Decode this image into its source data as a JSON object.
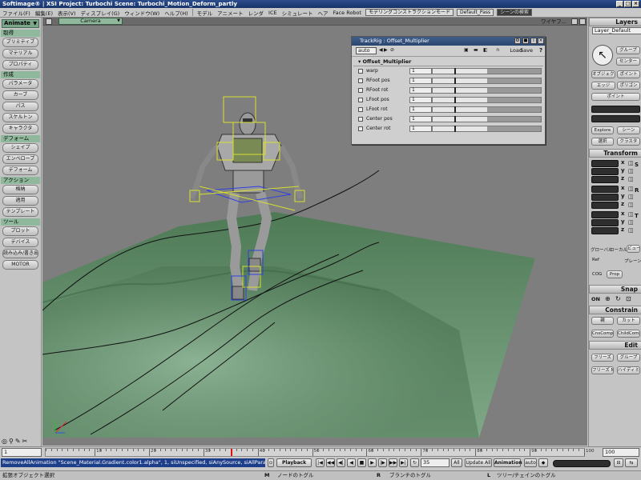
{
  "window": {
    "title": "Softimage® | XSI Project: Turbochi   Scene: Turbochi_Motion_Deform_partly",
    "buttons": [
      "_",
      "□",
      "×"
    ]
  },
  "menubar": {
    "items": [
      "ファイル(F)",
      "編集(E)",
      "表示(V)",
      "ディスプレイ(G)",
      "ウィンドウ(W)",
      "ヘルプ(H)",
      "モデル",
      "アニメート",
      "レンダ",
      "ICE",
      "シミュレート",
      "ヘア",
      "Face Robot"
    ],
    "mode_field": "モデリングコンストラクションモード",
    "pass_field": "Default_Pass",
    "search_placeholder": "シーンの検索"
  },
  "left_panel": {
    "mode": "Animate",
    "sections": [
      {
        "header": "取得",
        "buttons": [
          "プリミティブ",
          "マテリアル",
          "プロパティ"
        ]
      },
      {
        "header": "作成",
        "buttons": [
          "パラメータ",
          "カーブ",
          "パス",
          "スケルトン",
          "キャラクタ"
        ]
      },
      {
        "header": "デフォーム",
        "buttons": [
          "シェイプ",
          "エンベロープ",
          "デフォーム"
        ]
      },
      {
        "header": "アクション",
        "buttons": [
          "格納",
          "適用",
          "テンプレート"
        ]
      },
      {
        "header": "ツール",
        "buttons": [
          "プロット",
          "デバイス",
          "読み込み/書き出し",
          "MOTOR"
        ]
      }
    ]
  },
  "viewport": {
    "camera": "Camera",
    "view_label": "ワイヤフ...",
    "ground_color": "#5f8a66",
    "background_color": "#7e7e7e"
  },
  "property_panel": {
    "title": "TrackRig : Offset_Multiplier",
    "auto": "auto",
    "load": "Load",
    "save": "Save",
    "help": "?",
    "group": "Offset_Multiplier",
    "rows": [
      {
        "label": "warp",
        "value": "1",
        "level": 0.5
      },
      {
        "label": "RFoot pos",
        "value": "1",
        "level": 0.5
      },
      {
        "label": "RFoot rot",
        "value": "1",
        "level": 0.5
      },
      {
        "label": "LFoot pos",
        "value": "1",
        "level": 0.5
      },
      {
        "label": "LFoot rot",
        "value": "1",
        "level": 0.5
      },
      {
        "label": "Center pos",
        "value": "1",
        "level": 0.5
      },
      {
        "label": "Center rot",
        "value": "1",
        "level": 0.5
      }
    ]
  },
  "right_panel": {
    "layers_title": "Layers",
    "layer_field": "Layer_Default",
    "select_buttons": [
      "グループ",
      "センター",
      "オブジェクト",
      "ポイント",
      "エッジ",
      "ポリゴン",
      "ポイント"
    ],
    "explore": "Explore",
    "scene": "シーン",
    "select": "選択",
    "clusters": "クラスタ",
    "transform_title": "Transform",
    "axes": [
      "x",
      "y",
      "z"
    ],
    "transform_letters": [
      "S",
      "R",
      "T"
    ],
    "space_labels": [
      "グローバル",
      "ローカル",
      "ビュー"
    ],
    "ref": "Ref",
    "plane": "プレーン",
    "prop": "Prop",
    "cog": "COG",
    "snap_title": "Snap",
    "snap_on": "ON",
    "constrain_title": "Constrain",
    "constrain_buttons": [
      "親",
      "カット",
      "CnsComp",
      "ChildComp"
    ],
    "edit_title": "Edit",
    "edit_buttons": [
      "フリーズ",
      "グループ",
      "フリーズ M",
      "ハイディミット"
    ]
  },
  "timeline": {
    "start": "1",
    "end": "100",
    "current_frame": 35,
    "ticks": [
      "10",
      "20",
      "30",
      "40",
      "50",
      "60",
      "70",
      "80",
      "90",
      "100"
    ]
  },
  "command": {
    "text": "RemoveAllAnimation \"Scene_Material.Gradient.color1.alpha\", 1, siUnspecified, siAnySource, siAllParam",
    "playback": "Playback",
    "frame": "35",
    "all": "All",
    "update_all": "Update All",
    "animation": "Animation",
    "auto": "auto"
  },
  "statusbar": {
    "items": [
      "拡張オブジェクト選択",
      "ノードのトグル",
      "ブランチのトグル",
      "ツリー/チェインのトグル"
    ],
    "mouse_labels": [
      "L",
      "M",
      "R"
    ]
  }
}
